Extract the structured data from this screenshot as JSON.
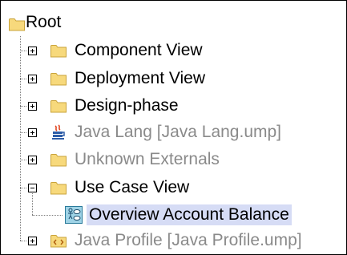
{
  "tree": {
    "root": {
      "label": "Root",
      "icon": "folder-icon",
      "expanded": true
    },
    "children": [
      {
        "label": "Component View",
        "icon": "folder-icon",
        "state": "collapsed",
        "disabled": false
      },
      {
        "label": "Deployment View",
        "icon": "folder-icon",
        "state": "collapsed",
        "disabled": false
      },
      {
        "label": "Design-phase",
        "icon": "folder-icon",
        "state": "collapsed",
        "disabled": false
      },
      {
        "label": "Java Lang [Java Lang.ump]",
        "icon": "java-package-icon",
        "state": "collapsed",
        "disabled": true
      },
      {
        "label": "Unknown Externals",
        "icon": "folder-icon",
        "state": "collapsed",
        "disabled": true
      },
      {
        "label": "Use Case View",
        "icon": "folder-icon",
        "state": "expanded",
        "disabled": false,
        "children": [
          {
            "label": "Overview Account Balance",
            "icon": "use-case-diagram-icon",
            "selected": true
          }
        ]
      },
      {
        "label": "Java Profile [Java Profile.ump]",
        "icon": "java-profile-icon",
        "state": "collapsed",
        "disabled": true
      }
    ]
  },
  "colors": {
    "selection_background": "#d6dcf5",
    "disabled_text": "#8a8a8a",
    "folder_fill": "#f7d97c"
  }
}
